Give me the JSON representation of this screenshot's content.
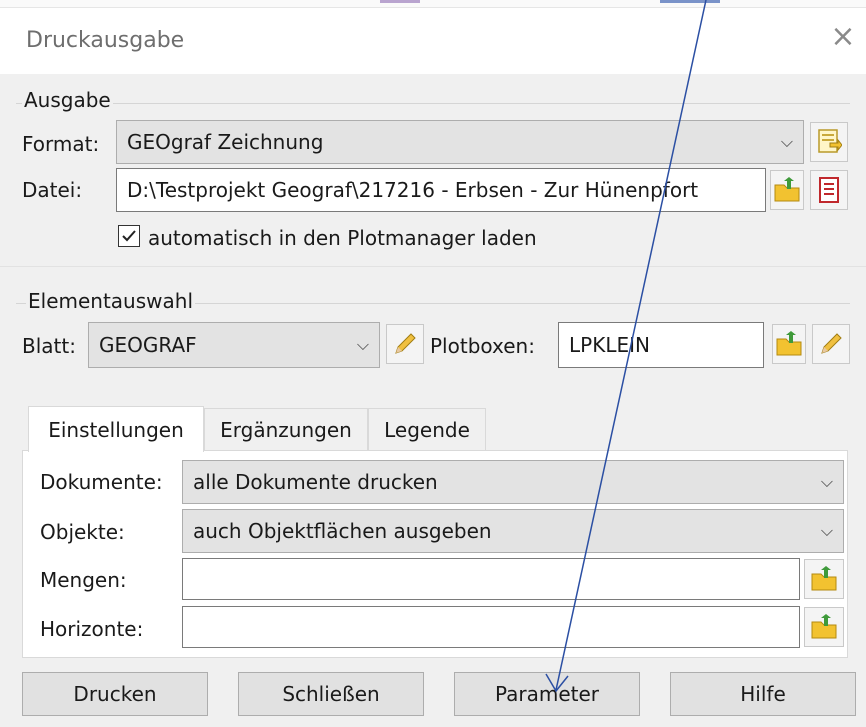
{
  "window": {
    "title": "Druckausgabe",
    "close_symbol": "×"
  },
  "ausgabe": {
    "group_label": "Ausgabe",
    "format_label": "Format:",
    "format_value": "GEOgraf Zeichnung",
    "datei_label": "Datei:",
    "datei_value": "D:\\Testprojekt Geograf\\217216 - Erbsen - Zur Hünenpfort",
    "checkbox_label": "automatisch in den Plotmanager laden",
    "checkbox_checked": true
  },
  "elementauswahl": {
    "group_label": "Elementauswahl",
    "blatt_label": "Blatt:",
    "blatt_value": "GEOGRAF",
    "plotboxen_label": "Plotboxen:",
    "plotboxen_value": "LPKLEIN"
  },
  "tabs": [
    {
      "label": "Einstellungen",
      "active": true
    },
    {
      "label": "Ergänzungen",
      "active": false
    },
    {
      "label": "Legende",
      "active": false
    }
  ],
  "settings": {
    "dokumente_label": "Dokumente:",
    "dokumente_value": "alle Dokumente drucken",
    "objekte_label": "Objekte:",
    "objekte_value": "auch Objektflächen ausgeben",
    "mengen_label": "Mengen:",
    "mengen_value": "",
    "horizonte_label": "Horizonte:",
    "horizonte_value": ""
  },
  "buttons": {
    "drucken": "Drucken",
    "schliessen": "Schließen",
    "parameter": "Parameter",
    "hilfe": "Hilfe"
  },
  "colors": {
    "annotation_arrow": "#2b4fa3",
    "folder_icon": "#f2c230",
    "folder_arrow": "#3f9a3a",
    "pencil": "#f0c040"
  },
  "icons": [
    "folder-open-icon",
    "pencil-icon",
    "document-list-icon",
    "format-settings-icon",
    "chevron-down-icon",
    "checkmark-icon"
  ]
}
